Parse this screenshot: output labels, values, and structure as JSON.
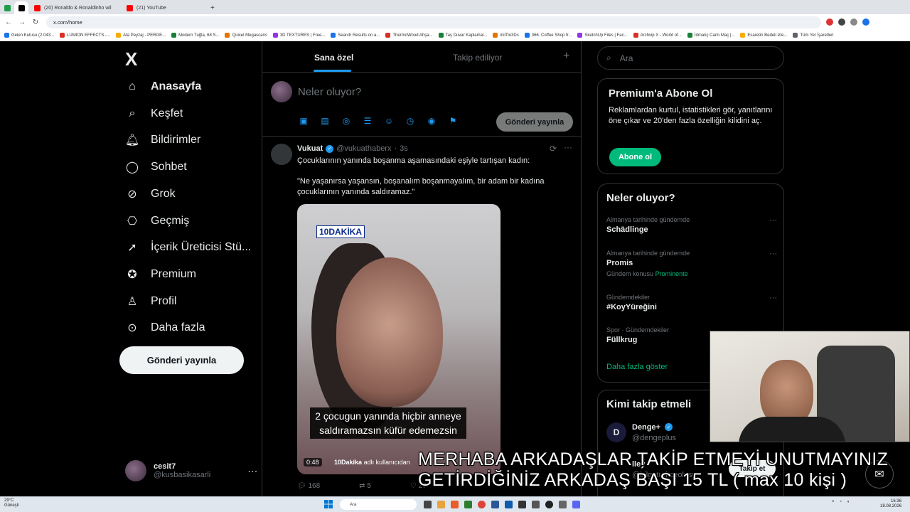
{
  "browser": {
    "tabs": [
      {
        "label": "",
        "color": "#1e9e4a"
      },
      {
        "label": "",
        "color": "#000000"
      },
      {
        "label": "(20) Ronaldo & Ronaldinho wil",
        "color": "#ff0000"
      },
      {
        "label": "(21) YouTube",
        "color": "#ff0000"
      }
    ],
    "address": "x.com/home",
    "bookmarks": [
      "Gelen Kutusu (2.043...",
      "LUMION EFFECTS -...",
      "Ata Peyzaj - PERGE...",
      "Modern Tuğla, 68 S...",
      "Quixel Megascans",
      "3D TEXTURES | Free...",
      "Search Results on a...",
      "ThermoWood Ahşa...",
      "Taş Duvar Kaplamal...",
      "milTio3Ds",
      "366. Coffee Shop fr...",
      "SketchUp Files | Fac...",
      "Archvip X - World of...",
      "İdmanç Canlı Maç |...",
      "Esaretin Bedeli izle...",
      "Tüm Yer İşaretleri"
    ]
  },
  "sidebar": {
    "logo": "X",
    "items": [
      {
        "label": "Anasayfa",
        "icon": "home-icon"
      },
      {
        "label": "Keşfet",
        "icon": "search-icon"
      },
      {
        "label": "Bildirimler",
        "icon": "bell-icon"
      },
      {
        "label": "Sohbet",
        "icon": "chat-icon"
      },
      {
        "label": "Grok",
        "icon": "grok-icon"
      },
      {
        "label": "Geçmiş",
        "icon": "bookmark-icon"
      },
      {
        "label": "İçerik Üreticisi Stü...",
        "icon": "rocket-icon"
      },
      {
        "label": "Premium",
        "icon": "verified-icon"
      },
      {
        "label": "Profil",
        "icon": "person-icon"
      },
      {
        "label": "Daha fazla",
        "icon": "more-circle-icon"
      }
    ],
    "post_button": "Gönderi yayınla",
    "account": {
      "name": "cesit7",
      "handle": "@kusbasikasarli"
    }
  },
  "feed": {
    "tabs": [
      "Sana özel",
      "Takip ediliyor"
    ],
    "composer": {
      "placeholder": "Neler oluyor?",
      "post_button": "Gönderi yayınla"
    },
    "tweet": {
      "author": "Vukuat",
      "handle": "@vukuathaberx",
      "time": "3s",
      "text1": "Çocuklarının yanında boşanma aşamasındaki eşiyle tartışan kadın:",
      "text2": "\"Ne yaşanırsa yaşansın, boşanalım boşanmayalım, bir adam bir kadına çocuklarının yanında saldıramaz.\"",
      "media": {
        "logo": "10DAKİKA",
        "caption": "2 çocugun yanında hiçbir anneye saldıramazsın küfür edemezsin",
        "duration": "0:48",
        "credit_name": "10Dakika",
        "credit_suffix": "adlı kullanıcıdan"
      },
      "replies": "168",
      "reposts": "5",
      "likes": "27"
    }
  },
  "right": {
    "search_placeholder": "Ara",
    "premium": {
      "title": "Premium'a Abone Ol",
      "text": "Reklamlardan kurtul, istatistikleri gör, yanıtlarını öne çıkar ve 20'den fazla özelliğin kilidini aç.",
      "button": "Abone ol"
    },
    "trends_title": "Neler oluyor?",
    "trends": [
      {
        "meta": "Almanya tarihinde gündemde",
        "name": "Schädlinge",
        "extra": ""
      },
      {
        "meta": "Almanya tarihinde gündemde",
        "name": "Promis",
        "extra": "Gündem konusu",
        "extra_green": "Prominente"
      },
      {
        "meta": "Gündemdekiler",
        "name": "#KoyYüreğini",
        "extra": ""
      },
      {
        "meta": "Spor · Gündemdekiler",
        "name": "Füllkrug",
        "extra": ""
      }
    ],
    "show_more": "Daha fazla göster",
    "who_to_follow_title": "Kimi takip etmeli",
    "follow": [
      {
        "name": "Denge+",
        "handle": "@dengeplus"
      },
      {
        "name": "lley",
        "handle": "@bilgeturkceolusu"
      }
    ],
    "follow_button": "Takip et"
  },
  "overlay": {
    "line1": "MERHABA ARKADAŞLAR TAKİP ETMEYİ UNUTMAYINIZ",
    "line2": "GETİRDİĞİNİZ ARKADAŞ BAŞI 15 TL ( max 10 kişi )"
  },
  "taskbar": {
    "weather_temp": "29°C",
    "weather_desc": "Güneşli",
    "search": "Ara",
    "time": "16:36",
    "date": "18.08.2026"
  },
  "colors": {
    "accent": "#1d9bf0",
    "green": "#00ba7c",
    "bg": "#000000",
    "border": "#2f3336"
  }
}
